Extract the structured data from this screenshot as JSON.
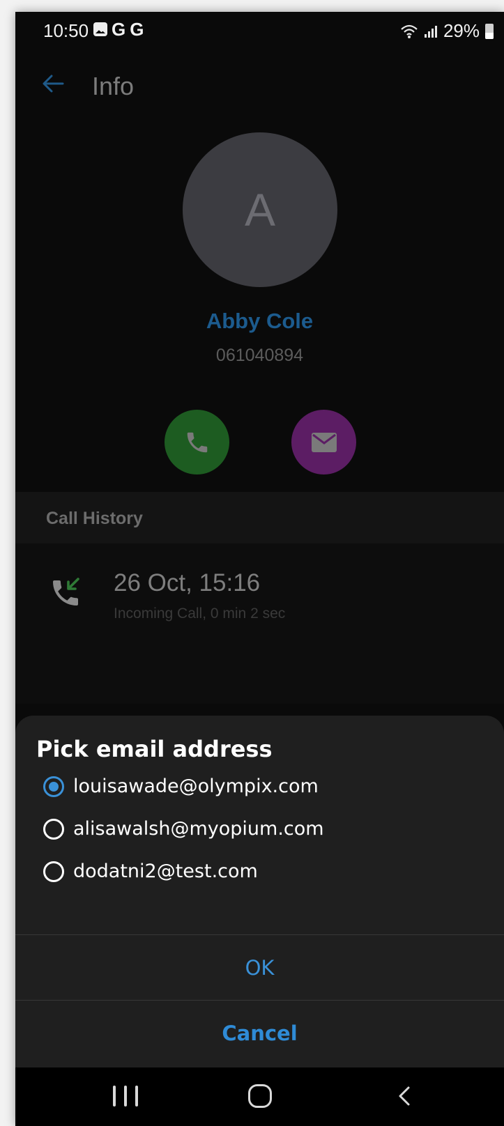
{
  "status_bar": {
    "time": "10:50",
    "notification_icons": [
      "gallery-icon",
      "google-icon",
      "google-icon"
    ],
    "notification_letters": [
      "G",
      "G"
    ],
    "system_icons": [
      "wifi-icon",
      "signal-icon",
      "battery-icon"
    ],
    "battery": "29%"
  },
  "header": {
    "back_icon": "arrow-left-icon",
    "title": "Info"
  },
  "contact": {
    "avatar_letter": "A",
    "name": "Abby Cole",
    "number": "061040894",
    "call_icon": "phone-icon",
    "email_icon": "envelope-icon"
  },
  "call_history": {
    "title": "Call History",
    "items": [
      {
        "icon": "incoming-call-icon",
        "datetime": "26 Oct, 15:16",
        "detail": "Incoming Call, 0 min 2 sec"
      }
    ]
  },
  "dialog": {
    "title": "Pick email address",
    "options": [
      {
        "label": "louisawade@olympix.com",
        "selected": true
      },
      {
        "label": "alisawalsh@myopium.com",
        "selected": false
      },
      {
        "label": "dodatni2@test.com",
        "selected": false
      }
    ],
    "ok_label": "OK",
    "cancel_label": "Cancel"
  },
  "nav_bar": {
    "icons": [
      "recent-apps-icon",
      "home-icon",
      "back-icon"
    ]
  },
  "colors": {
    "accent": "#3a91d8",
    "call_button": "#1d5c21",
    "email_button": "#5c1d64",
    "contact_name": "#1c5b8e"
  }
}
